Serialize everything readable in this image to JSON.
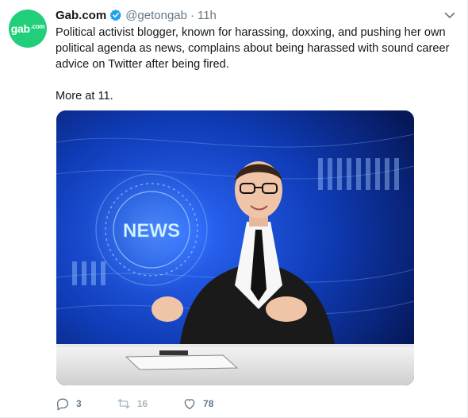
{
  "tweet": {
    "avatar_text": "gab",
    "avatar_suffix": ".com",
    "display_name": "Gab.com",
    "handle": "@getongab",
    "separator": "·",
    "time": "11h",
    "text_paragraph_1": "Political activist blogger, known for harassing, doxxing, and pushing her own political agenda as news, complains about being harassed with sound career advice on Twitter after being fired.",
    "text_paragraph_2": "More at 11.",
    "media": {
      "overlay_text": "NEWS"
    },
    "actions": {
      "replies": "3",
      "retweets": "16",
      "likes": "78"
    }
  },
  "colors": {
    "brand_green": "#21cf7a",
    "verified_blue": "#1da1f2",
    "secondary_text": "#657786",
    "muted_icon": "#aab8c2"
  },
  "icons": {
    "verified": "verified-badge-icon",
    "caret": "chevron-down-icon",
    "reply": "reply-icon",
    "retweet": "retweet-icon",
    "like": "heart-icon"
  }
}
